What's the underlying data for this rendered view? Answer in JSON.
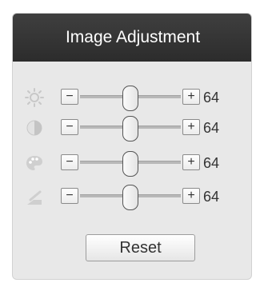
{
  "panel": {
    "title": "Image Adjustment",
    "reset_label": "Reset"
  },
  "controls": [
    {
      "id": "brightness",
      "icon": "sun-icon",
      "minus": "−",
      "plus": "+",
      "value": "64",
      "level": 0.5
    },
    {
      "id": "contrast",
      "icon": "contrast-icon",
      "minus": "−",
      "plus": "+",
      "value": "64",
      "level": 0.5
    },
    {
      "id": "saturation",
      "icon": "palette-icon",
      "minus": "−",
      "plus": "+",
      "value": "64",
      "level": 0.5
    },
    {
      "id": "sharpness",
      "icon": "sharpness-icon",
      "minus": "−",
      "plus": "+",
      "value": "64",
      "level": 0.5
    }
  ],
  "colors": {
    "header_bg": "#333333",
    "panel_bg": "#e8e8e8",
    "icon_color": "#cfcfcf"
  }
}
